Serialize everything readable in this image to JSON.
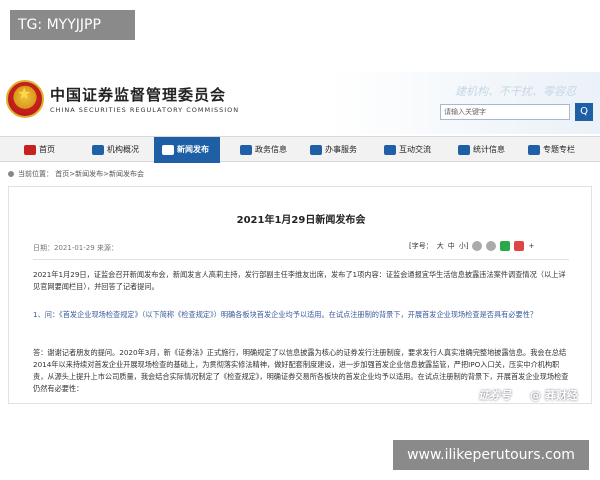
{
  "overlay": {
    "top_tag": "TG: MYYJJPP",
    "bottom_tag": "www.ilikeperutours.com"
  },
  "site": {
    "name": "中国证券监督管理委员会",
    "name_en": "CHINA SECURITIES REGULATORY COMMISSION",
    "slogan": "建机构、不干扰、零容忍",
    "search_placeholder": "请输入关键字",
    "search_button": "Q"
  },
  "nav": [
    {
      "label": "首页"
    },
    {
      "label": "机构概况"
    },
    {
      "label": "新闻发布",
      "active": true
    },
    {
      "label": "政务信息"
    },
    {
      "label": "办事服务"
    },
    {
      "label": "互动交流"
    },
    {
      "label": "统计信息"
    },
    {
      "label": "专题专栏"
    }
  ],
  "breadcrumb": "当前位置： 首页>新闻发布>新闻发布会",
  "article": {
    "title": "2021年1月29日新闻发布会",
    "meta": "日期：2021-01-29    来源：",
    "font_size_label": "[字号：",
    "font_large": "大",
    "font_medium": "中",
    "font_small": "小]",
    "plus": "+",
    "paragraphs": [
      "2021年1月29日，证监会召开新闻发布会，新闻发言人高莉主持，发行部副主任李维友出席，发布了1项内容：证监会通报宜华生活信息披露违法案件调查情况（以上详见官网要闻栏目），并回答了记者提问。",
      "1、问：《首发企业现场检查规定》（以下简称《检查规定》）明确各板块首发企业均予以适用。在试点注册制的背景下，开展首发企业现场检查是否具有必要性？",
      "答：谢谢记者朋友的提问。2020年3月，新《证券法》正式施行，明确规定了以信息披露为核心的证券发行注册制度，要求发行人真实准确完整地披露信息。我会在总结2014年以来持续对首发企业开展现场检查的基础上，为贯彻落实修法精神，做好配套制度建设，进一步加强首发企业信息披露监管，严把IPO入口关，压实中介机构职责，从源头上提升上市公司质量，我会结合实际情况制定了《检查规定》，明确证券交易所各板块的首发企业均予以适用。在试点注册制的背景下，开展首发企业现场检查仍然有必要性："
    ]
  },
  "watermark": {
    "left": "证券号",
    "right": "@ 莽财经"
  }
}
